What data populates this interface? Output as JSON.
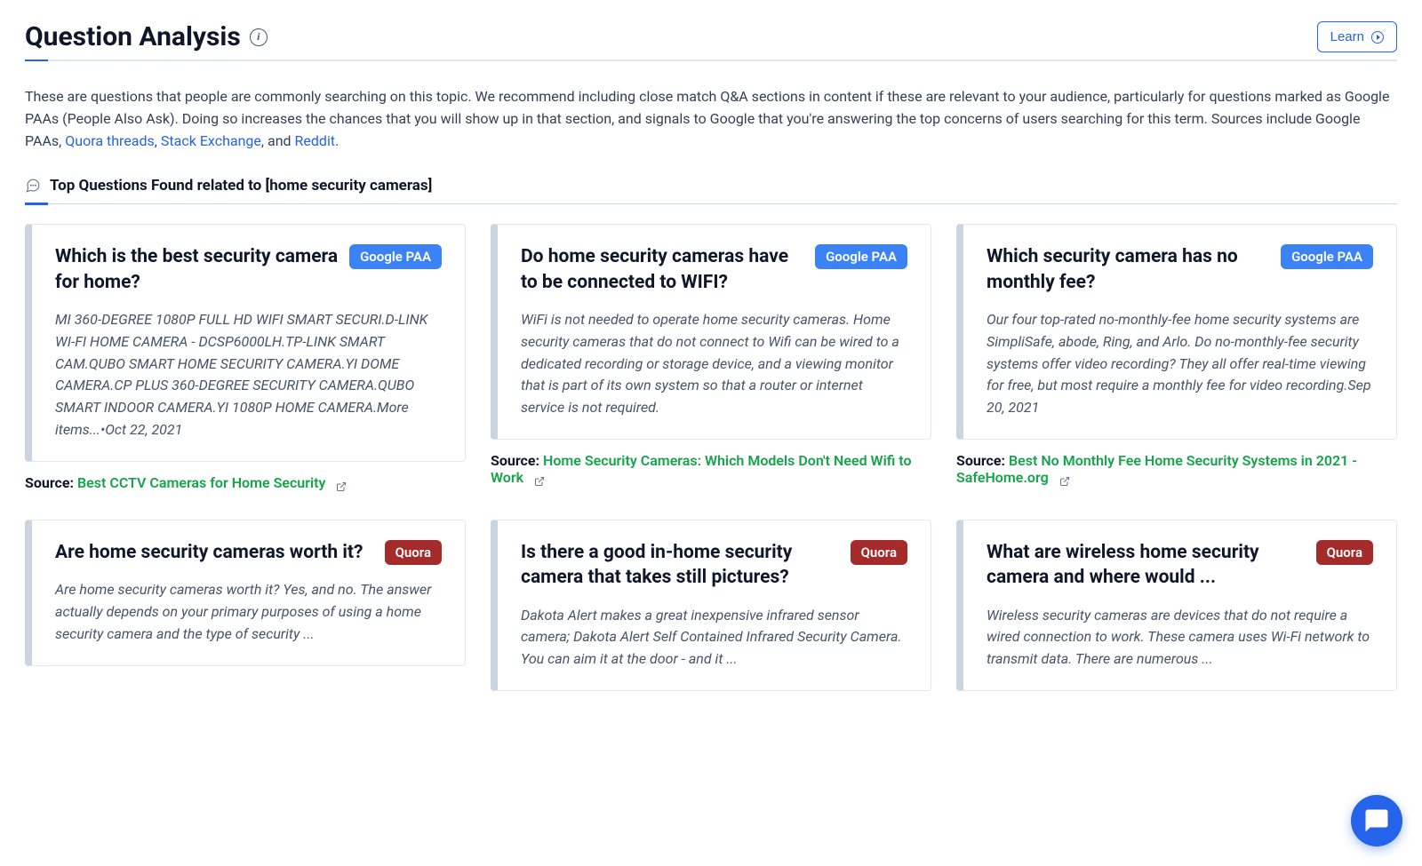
{
  "header": {
    "title": "Question Analysis",
    "learn_label": "Learn"
  },
  "intro": {
    "text_before_links": "These are questions that people are commonly searching on this topic. We recommend including close match Q&A sections in content if these are relevant to your audience, particularly for questions marked as Google PAAs (People Also Ask). Doing so increases the chances that you will show up in that section, and signals to Google that you're answering the top concerns of users searching for this term. Sources include Google PAAs, ",
    "link1": "Quora threads",
    "sep1": ", ",
    "link2": "Stack Exchange",
    "sep2": ", and ",
    "link3": "Reddit",
    "after": "."
  },
  "subhead": "Top Questions Found related to [home security cameras]",
  "badges": {
    "paa": "Google PAA",
    "quora": "Quora"
  },
  "source_label": "Source:",
  "cards": [
    {
      "title": "Which is the best security camera for home?",
      "badge": "paa",
      "body": "MI 360-DEGREE 1080P FULL HD WIFI SMART SECURI.D-LINK WI-FI HOME CAMERA - DCSP6000LH.TP-LINK SMART CAM.QUBO SMART HOME SECURITY CAMERA.YI DOME CAMERA.CP PLUS 360-DEGREE SECURITY CAMERA.QUBO SMART INDOOR CAMERA.YI 1080P HOME CAMERA.More items...•Oct 22, 2021",
      "source": "Best CCTV Cameras for Home Security"
    },
    {
      "title": "Do home security cameras have to be connected to WIFI?",
      "badge": "paa",
      "body": "WiFi is not needed to operate home security cameras. Home security cameras that do not connect to Wifi can be wired to a dedicated recording or storage device, and a viewing monitor that is part of its own system so that a router or internet service is not required.",
      "source": "Home Security Cameras: Which Models Don't Need Wifi to Work"
    },
    {
      "title": "Which security camera has no monthly fee?",
      "badge": "paa",
      "body": "Our four top-rated no-monthly-fee home security systems are SimpliSafe, abode, Ring, and Arlo. Do no-monthly-fee security systems offer video recording? They all offer real-time viewing for free, but most require a monthly fee for video recording.Sep 20, 2021",
      "source": "Best No Monthly Fee Home Security Systems in 2021 - SafeHome.org"
    },
    {
      "title": "Are home security cameras worth it?",
      "badge": "quora",
      "body": "Are home security cameras worth it? Yes, and no. The answer actually depends on your primary purposes of using a home security camera and the type of security ...",
      "source": ""
    },
    {
      "title": "Is there a good in-home security camera that takes still pictures?",
      "badge": "quora",
      "body": "Dakota Alert makes a great inexpensive infrared sensor camera; Dakota Alert Self Contained Infrared Security Camera. You can aim it at the door - and it ...",
      "source": ""
    },
    {
      "title": "What are wireless home security camera and where would ...",
      "badge": "quora",
      "body": "Wireless security cameras are devices that do not require a wired connection to work. These camera uses Wi-Fi network to transmit data. There are numerous ...",
      "source": ""
    }
  ]
}
